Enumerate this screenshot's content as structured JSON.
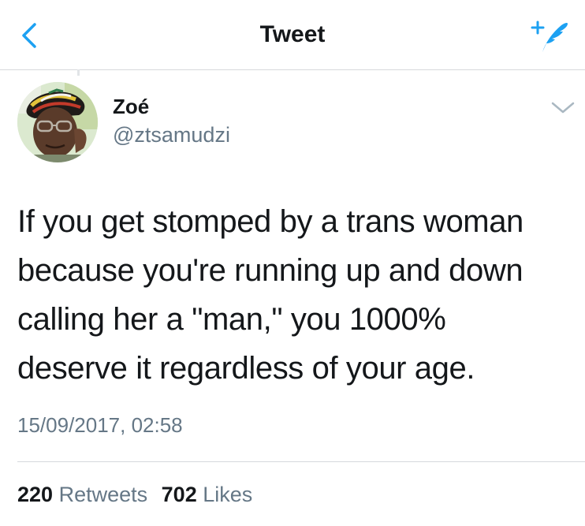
{
  "navbar": {
    "title": "Tweet",
    "back_icon": "chevron-left-icon",
    "compose_icon": "compose-tweet-icon",
    "accent_color": "#1da1f2"
  },
  "tweet": {
    "author_name": "Zoé",
    "author_handle": "@ztsamudzi",
    "menu_icon": "chevron-down-icon",
    "text_lines": [
      "If you get stomped by a trans woman",
      "because you're running up and down",
      "calling her a \"man,\" you 1000%",
      "deserve it regardless of your age."
    ],
    "timestamp": "15/09/2017, 02:58",
    "retweets_count": "220",
    "retweets_label": "Retweets",
    "likes_count": "702",
    "likes_label": "Likes"
  },
  "colors": {
    "text_primary": "#14171a",
    "text_secondary": "#657786",
    "divider": "#d6d9dc"
  }
}
